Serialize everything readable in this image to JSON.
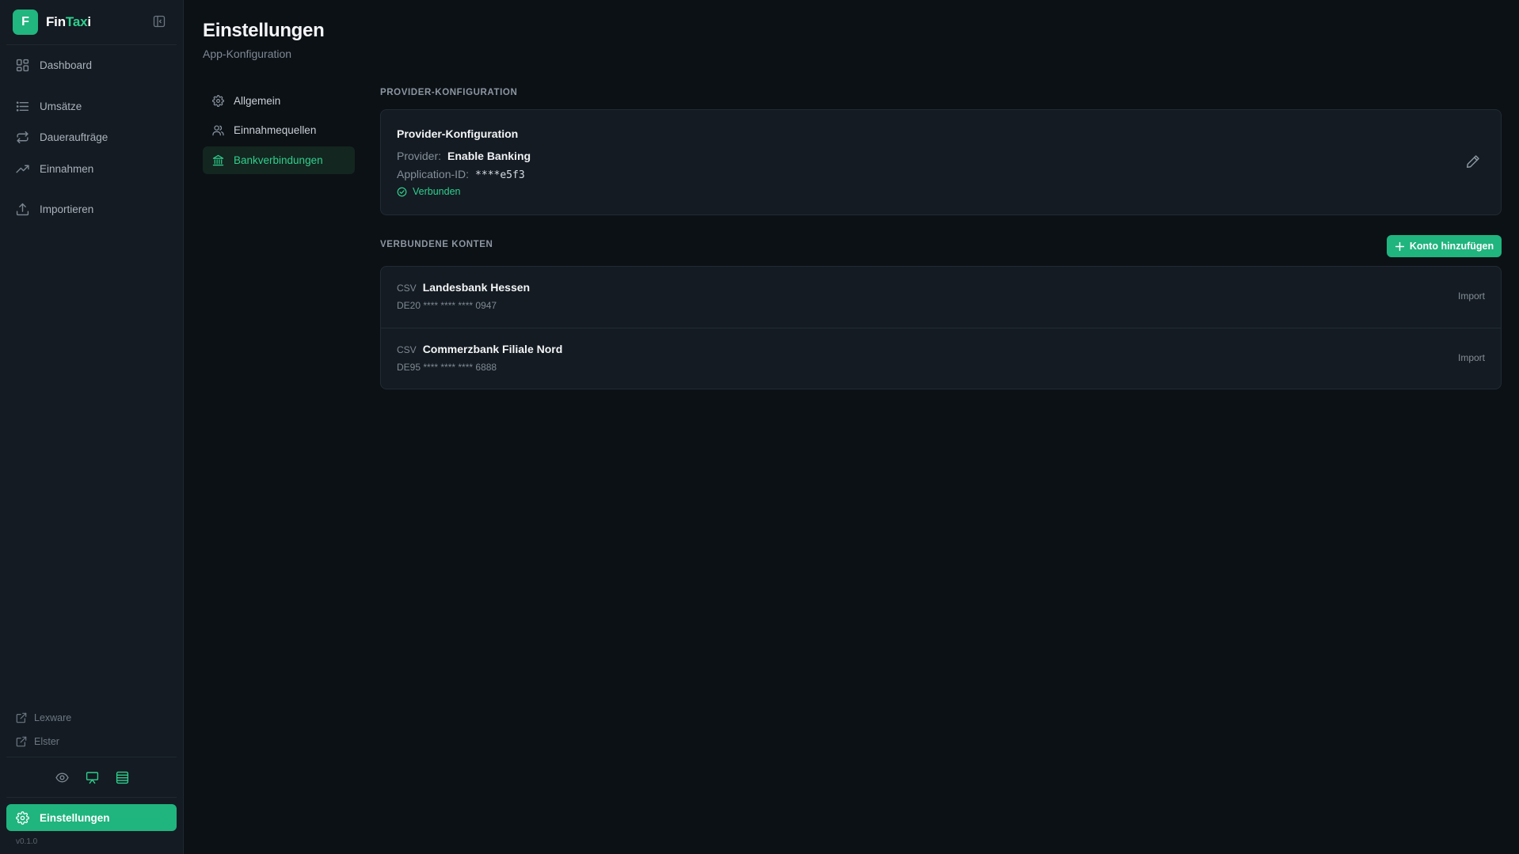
{
  "app": {
    "logo_letter": "F",
    "name_part1": "Fin",
    "name_part2": "Tax",
    "name_part3": "i",
    "version": "v0.1.0"
  },
  "colors": {
    "accent": "#20b47e",
    "accent_text": "#2fcf8e",
    "background": "#0c1116",
    "sidebar": "#141b22",
    "card": "#141b22"
  },
  "sidebar": {
    "nav": [
      {
        "label": "Dashboard",
        "icon": "dashboard-icon"
      },
      {
        "label": "Umsätze",
        "icon": "list-icon"
      },
      {
        "label": "Daueraufträge",
        "icon": "repeat-icon"
      },
      {
        "label": "Einnahmen",
        "icon": "trending-up-icon"
      },
      {
        "label": "Importieren",
        "icon": "upload-icon"
      }
    ],
    "external_links": [
      {
        "label": "Lexware",
        "icon": "external-link-icon"
      },
      {
        "label": "Elster",
        "icon": "external-link-icon"
      }
    ],
    "tools": [
      "eye-icon",
      "presentation-icon",
      "table-icon"
    ],
    "settings_label": "Einstellungen"
  },
  "page": {
    "title": "Einstellungen",
    "subtitle": "App-Konfiguration"
  },
  "settings_nav": [
    {
      "label": "Allgemein",
      "icon": "gear-icon"
    },
    {
      "label": "Einnahmequellen",
      "icon": "users-icon"
    },
    {
      "label": "Bankverbindungen",
      "icon": "bank-icon",
      "active": true
    }
  ],
  "provider_section": {
    "label": "PROVIDER-KONFIGURATION",
    "card_title": "Provider-Konfiguration",
    "provider_key": "Provider:",
    "provider_value": "Enable Banking",
    "app_id_key": "Application-ID:",
    "app_id_value": "****e5f3",
    "status": "Verbunden"
  },
  "accounts_section": {
    "label": "VERBUNDENE KONTEN",
    "add_button": "Konto hinzufügen",
    "accounts": [
      {
        "type": "CSV",
        "name": "Landesbank Hessen",
        "iban": "DE20 **** **** **** 0947",
        "action": "Import"
      },
      {
        "type": "CSV",
        "name": "Commerzbank Filiale Nord",
        "iban": "DE95 **** **** **** 6888",
        "action": "Import"
      }
    ]
  }
}
